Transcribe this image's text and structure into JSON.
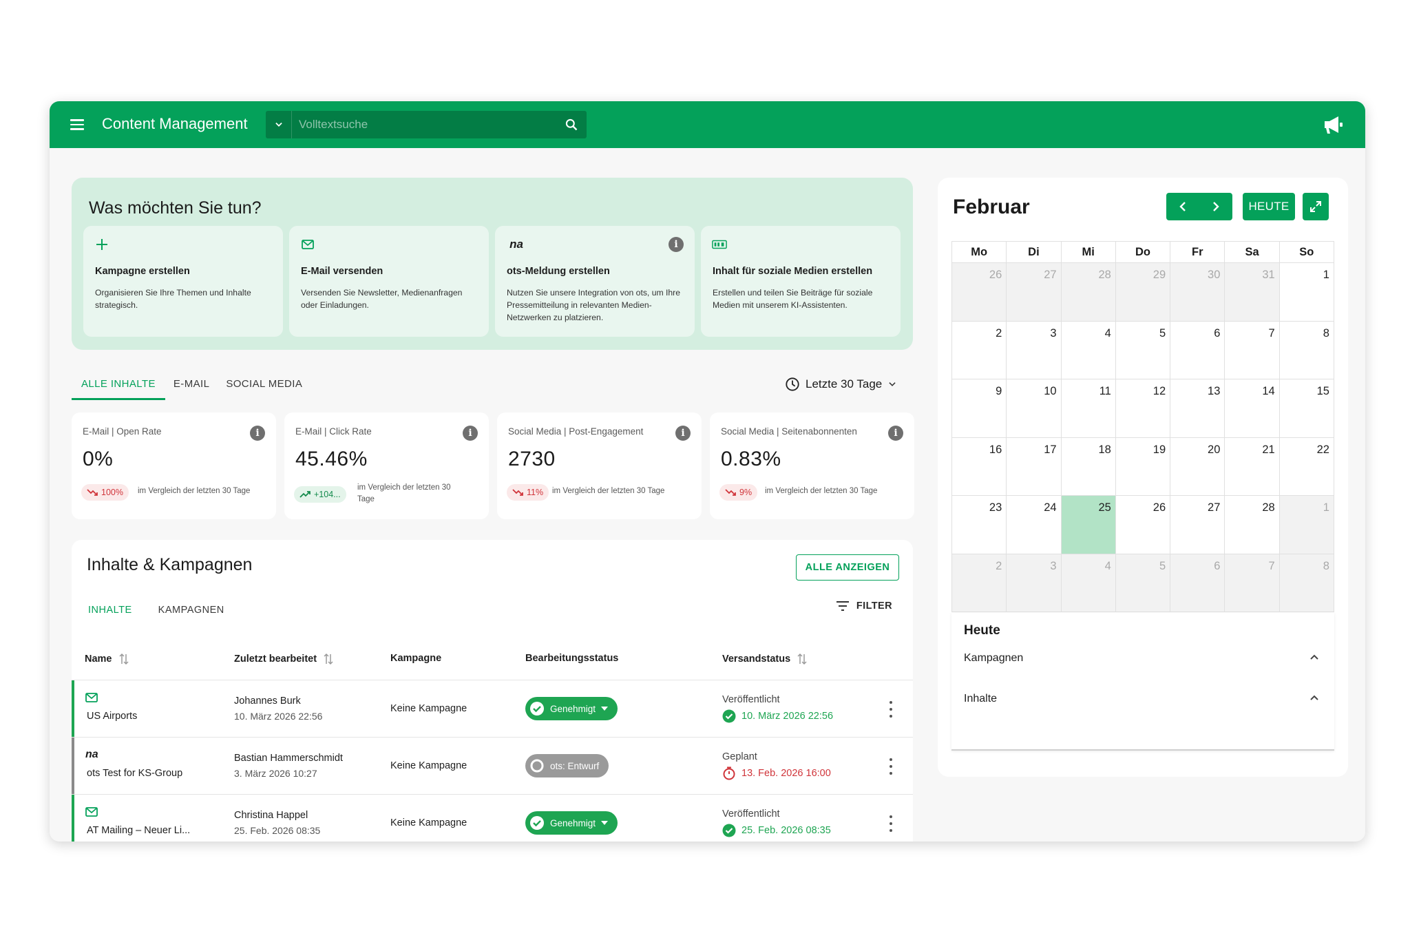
{
  "app": {
    "title": "Content Management"
  },
  "search": {
    "placeholder": "Volltextsuche"
  },
  "actions": {
    "title": "Was möchten Sie tun?",
    "cards": [
      {
        "icon": "plus-icon",
        "title": "Kampagne erstellen",
        "desc": "Organisieren Sie Ihre Themen und Inhalte strategisch."
      },
      {
        "icon": "envelope-icon",
        "title": "E-Mail versenden",
        "desc": "Versenden Sie Newsletter, Medienanfragen oder Einladungen."
      },
      {
        "icon": "na-logo-icon",
        "logo_text": "na",
        "title": "ots-Meldung erstellen",
        "desc": "Nutzen Sie unsere Integration von ots, um Ihre Pressemitteilung in relevanten Medien-Netzwerken zu platzieren.",
        "info": "i"
      },
      {
        "icon": "social-media-icon",
        "title": "Inhalt für soziale Medien erstellen",
        "desc": "Erstellen und teilen Sie Beiträge für soziale Medien mit unserem KI-Assistenten."
      }
    ]
  },
  "content_tabs": [
    "ALLE INHALTE",
    "E-MAIL",
    "SOCIAL MEDIA"
  ],
  "range": {
    "label": "Letzte 30 Tage"
  },
  "kpis": [
    {
      "label": "E-Mail | Open Rate",
      "value": "0%",
      "change": "100%",
      "direction": "down",
      "compare": "im Vergleich der letzten 30 Tage"
    },
    {
      "label": "E-Mail | Click Rate",
      "value": "45.46%",
      "change": "+104...",
      "direction": "up",
      "compare": "im Vergleich der letzten 30 Tage"
    },
    {
      "label": "Social Media | Post-Engagement",
      "value": "2730",
      "change": "11%",
      "direction": "down",
      "compare": "im Vergleich der letzten 30 Tage"
    },
    {
      "label": "Social Media | Seitenabonnenten",
      "value": "0.83%",
      "change": "9%",
      "direction": "down",
      "compare": "im Vergleich der letzten 30 Tage"
    }
  ],
  "info_glyph": "i",
  "table": {
    "title": "Inhalte & Kampagnen",
    "all_button": "ALLE ANZEIGEN",
    "tabs": [
      "INHALTE",
      "KAMPAGNEN"
    ],
    "filter": "FILTER",
    "headers": [
      "Name",
      "Zuletzt bearbeitet",
      "Kampagne",
      "Bearbeitungsstatus",
      "Versandstatus"
    ],
    "rows": [
      {
        "type": "email",
        "name": "US Airports",
        "editor": "Johannes Burk",
        "edited": "10. März 2026 22:56",
        "campaign": "Keine Kampagne",
        "status": "Genehmigt",
        "status_kind": "approved",
        "send_label": "Veröffentlicht",
        "send_date": "10. März 2026 22:56",
        "send_kind": "published",
        "accent": "#1ea552"
      },
      {
        "type": "ots",
        "logo_text": "na",
        "name": "ots Test for KS-Group",
        "editor": "Bastian Hammerschmidt",
        "edited": "3. März 2026 10:27",
        "campaign": "Keine Kampagne",
        "status": "ots: Entwurf",
        "status_kind": "draft",
        "send_label": "Geplant",
        "send_date": "13. Feb. 2026 16:00",
        "send_kind": "scheduled",
        "accent": "#8a8a8a"
      },
      {
        "type": "email",
        "name": "AT Mailing – Neuer Li...",
        "editor": "Christina Happel",
        "edited": "25. Feb. 2026 08:35",
        "campaign": "Keine Kampagne",
        "status": "Genehmigt",
        "status_kind": "approved",
        "send_label": "Veröffentlicht",
        "send_date": "25. Feb. 2026 08:35",
        "send_kind": "published",
        "accent": "#1ea552"
      }
    ]
  },
  "calendar": {
    "month": "Februar",
    "today_button": "HEUTE",
    "weekdays": [
      "Mo",
      "Di",
      "Mi",
      "Do",
      "Fr",
      "Sa",
      "So"
    ],
    "weeks": [
      [
        {
          "d": "26",
          "o": true
        },
        {
          "d": "27",
          "o": true
        },
        {
          "d": "28",
          "o": true
        },
        {
          "d": "29",
          "o": true
        },
        {
          "d": "30",
          "o": true
        },
        {
          "d": "31",
          "o": true
        },
        {
          "d": "1"
        }
      ],
      [
        {
          "d": "2"
        },
        {
          "d": "3"
        },
        {
          "d": "4"
        },
        {
          "d": "5"
        },
        {
          "d": "6"
        },
        {
          "d": "7"
        },
        {
          "d": "8"
        }
      ],
      [
        {
          "d": "9"
        },
        {
          "d": "10"
        },
        {
          "d": "11"
        },
        {
          "d": "12"
        },
        {
          "d": "13"
        },
        {
          "d": "14"
        },
        {
          "d": "15"
        }
      ],
      [
        {
          "d": "16"
        },
        {
          "d": "17"
        },
        {
          "d": "18"
        },
        {
          "d": "19"
        },
        {
          "d": "20"
        },
        {
          "d": "21"
        },
        {
          "d": "22"
        }
      ],
      [
        {
          "d": "23"
        },
        {
          "d": "24"
        },
        {
          "d": "25",
          "today": true
        },
        {
          "d": "26"
        },
        {
          "d": "27"
        },
        {
          "d": "28"
        },
        {
          "d": "1",
          "o": true
        }
      ],
      [
        {
          "d": "2",
          "o": true
        },
        {
          "d": "3",
          "o": true
        },
        {
          "d": "4",
          "o": true
        },
        {
          "d": "5",
          "o": true
        },
        {
          "d": "6",
          "o": true
        },
        {
          "d": "7",
          "o": true
        },
        {
          "d": "8",
          "o": true
        }
      ]
    ],
    "today_section": {
      "title": "Heute",
      "items": [
        "Kampagnen",
        "Inhalte"
      ]
    }
  },
  "colors": {
    "brand": "#04a15a",
    "brand_dark": "#037d45",
    "panel": "#d4eee0",
    "today": "#b2e3c6",
    "danger": "#d0343a"
  }
}
